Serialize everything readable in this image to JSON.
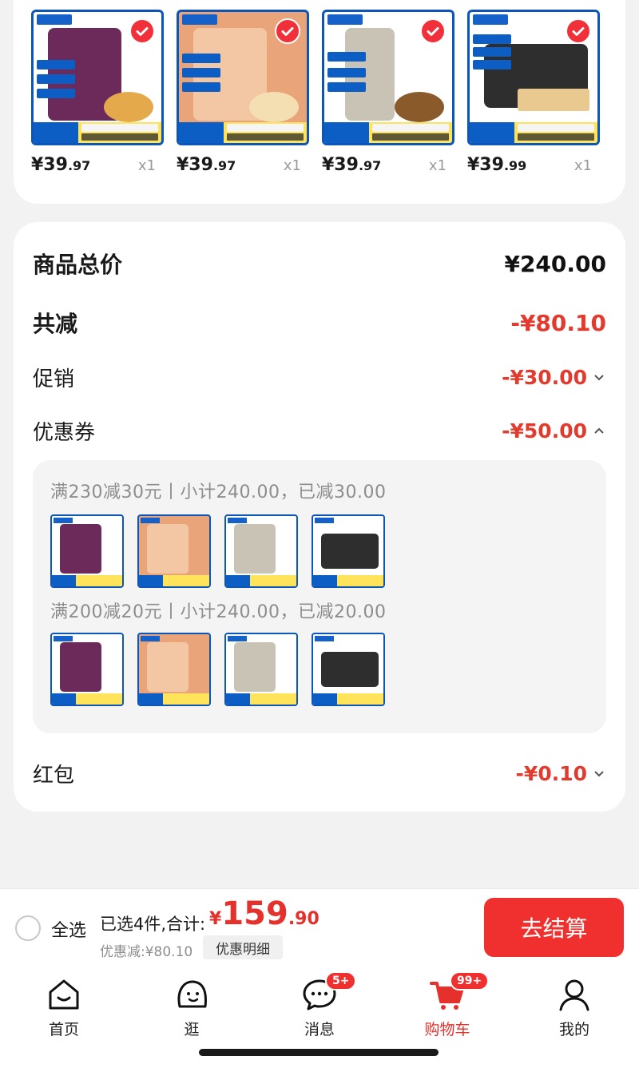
{
  "products": [
    {
      "price_int": "¥39",
      "price_dec": ".97",
      "qty": "x1",
      "pack_color": "#6b2a59",
      "snack_color": "#e3a94a"
    },
    {
      "price_int": "¥39",
      "price_dec": ".97",
      "qty": "x1",
      "pack_color": "#f0b08a",
      "snack_color": "#f4dfb2"
    },
    {
      "price_int": "¥39",
      "price_dec": ".97",
      "qty": "x1",
      "pack_color": "#c9c3b5",
      "snack_color": "#8a5a2b"
    },
    {
      "price_int": "¥39",
      "price_dec": ".99",
      "qty": "x1",
      "pack_color": "#2e2e2e",
      "snack_color": "#e9c98f"
    }
  ],
  "summary": {
    "goods_total_label": "商品总价",
    "goods_total_value": "¥240.00",
    "reduce_label": "共减",
    "reduce_value": "-¥80.10",
    "promo_label": "促销",
    "promo_value": "-¥30.00",
    "coupon_label": "优惠券",
    "coupon_value": "-¥50.00",
    "redpacket_label": "红包",
    "redpacket_value": "-¥0.10"
  },
  "coupons": [
    {
      "text": "满230减30元丨小计240.00，已减30.00"
    },
    {
      "text": "满200减20元丨小计240.00，已减20.00"
    }
  ],
  "checkout": {
    "select_all": "全选",
    "selected_text": "已选4件,合计:",
    "total_currency": "¥",
    "total_int": "159",
    "total_dec": ".90",
    "discount_text": "优惠减:¥80.10",
    "detail_button": "优惠明细",
    "pay_button": "去结算"
  },
  "tabs": [
    {
      "label": "首页",
      "icon": "home-icon"
    },
    {
      "label": "逛",
      "icon": "browse-icon"
    },
    {
      "label": "消息",
      "icon": "message-icon",
      "badge": "5+"
    },
    {
      "label": "购物车",
      "icon": "cart-icon",
      "badge": "99+",
      "active": true
    },
    {
      "label": "我的",
      "icon": "profile-icon"
    }
  ],
  "colors": {
    "accent": "#f0302e",
    "price_red": "#e23a2c",
    "brand_blue": "#0b56b8"
  }
}
